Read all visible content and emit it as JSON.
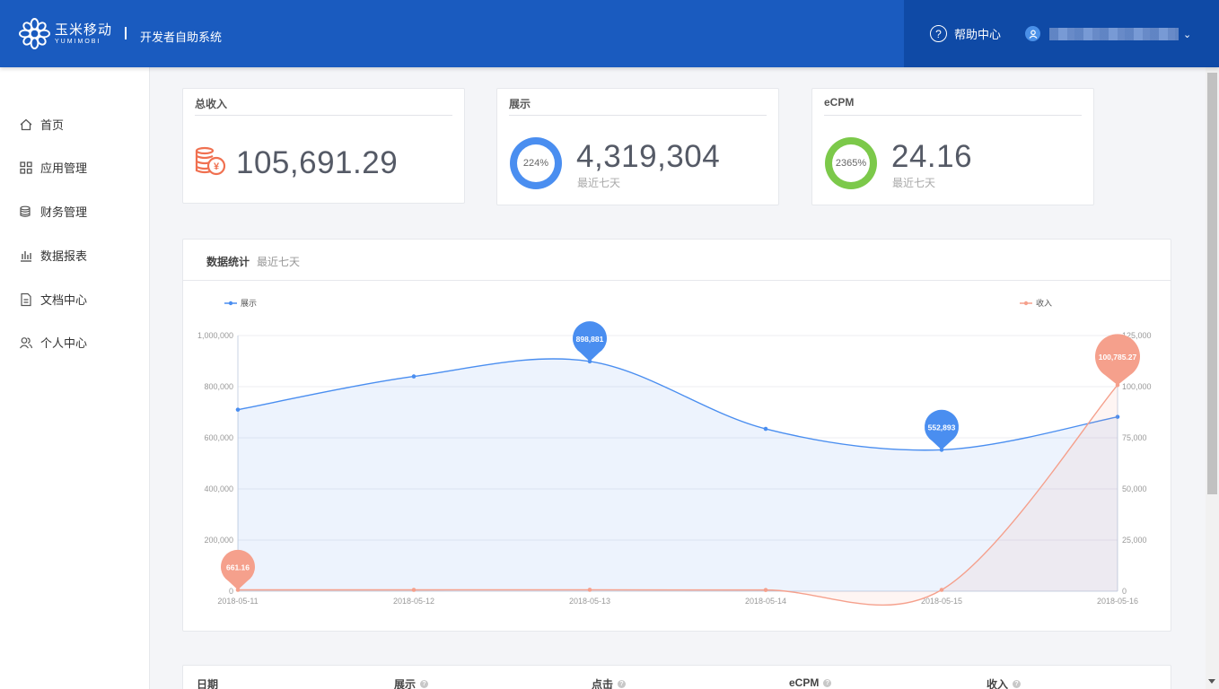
{
  "header": {
    "logo_cn": "玉米移动",
    "logo_en": "YUMIMOBI",
    "system_title": "开发者自助系统",
    "help_label": "帮助中心",
    "caret": "⌄"
  },
  "sidebar": {
    "items": [
      {
        "label": "首页",
        "icon": "home-icon"
      },
      {
        "label": "应用管理",
        "icon": "apps-grid-icon"
      },
      {
        "label": "财务管理",
        "icon": "coins-icon"
      },
      {
        "label": "数据报表",
        "icon": "bar-chart-icon"
      },
      {
        "label": "文档中心",
        "icon": "document-icon"
      },
      {
        "label": "个人中心",
        "icon": "users-icon"
      }
    ]
  },
  "cards": {
    "revenue": {
      "title": "总收入",
      "value": "105,691.29",
      "icon": "coin-stack-yuan-icon"
    },
    "impressions": {
      "title": "展示",
      "value": "4,319,304",
      "ring_label": "224%",
      "sub": "最近七天",
      "color": "#4a8ef0"
    },
    "ecpm": {
      "title": "eCPM",
      "value": "24.16",
      "ring_label": "2365%",
      "sub": "最近七天",
      "color": "#7cc94a"
    }
  },
  "chart_panel": {
    "title": "数据统计",
    "subtitle": "最近七天"
  },
  "chart_data": {
    "type": "line",
    "x": [
      "2018-05-11",
      "2018-05-12",
      "2018-05-13",
      "2018-05-14",
      "2018-05-15",
      "2018-05-16"
    ],
    "series": [
      {
        "name": "展示",
        "axis": "left",
        "color": "#4a8ef0",
        "values": [
          710000,
          840000,
          898881,
          635000,
          552893,
          682000
        ],
        "markers": [
          {
            "index": 2,
            "label": "898,881"
          },
          {
            "index": 4,
            "label": "552,893"
          }
        ]
      },
      {
        "name": "收入",
        "axis": "right",
        "color": "#f5a08c",
        "values": [
          661.16,
          661.16,
          700,
          600,
          661.16,
          100785.27
        ],
        "markers": [
          {
            "index": 0,
            "label": "661.16"
          },
          {
            "index": 5,
            "label": "100,785.27"
          }
        ]
      }
    ],
    "y_left": {
      "ticks": [
        0,
        200000,
        400000,
        600000,
        800000,
        1000000
      ],
      "tick_labels": [
        "0",
        "200,000",
        "400,000",
        "600,000",
        "800,000",
        "1,000,000"
      ],
      "ylim": [
        0,
        1000000
      ]
    },
    "y_right": {
      "ticks": [
        0,
        25000,
        50000,
        75000,
        100000,
        125000
      ],
      "tick_labels": [
        "0",
        "25,000",
        "50,000",
        "75,000",
        "100,000",
        "125,000"
      ],
      "ylim": [
        0,
        125000
      ]
    },
    "legend_placement": "top",
    "grid": true
  },
  "table": {
    "headers": [
      {
        "label": "日期",
        "help": false
      },
      {
        "label": "展示",
        "help": true
      },
      {
        "label": "点击",
        "help": true
      },
      {
        "label": "eCPM",
        "help": true
      },
      {
        "label": "收入",
        "help": true
      }
    ]
  }
}
